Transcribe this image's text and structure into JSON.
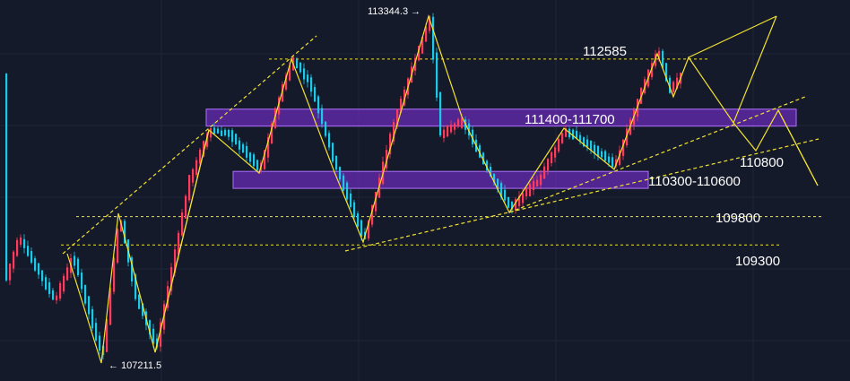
{
  "chart_data": {
    "type": "candlestick",
    "title": "",
    "xlabel": "",
    "ylabel": "",
    "ylim": [
      106500,
      114000
    ],
    "colors": {
      "background": "#141a2a",
      "up_candle": "#ff3b5c",
      "down_candle": "#1ec8e6",
      "annotation": "#f2e230",
      "zone_fill": "#7a2fd6",
      "zone_border": "#b070ff",
      "text": "#ffffff"
    },
    "candles": [],
    "levels": [
      {
        "label": "112585",
        "value": 112585
      },
      {
        "label": "109800",
        "value": 109800
      },
      {
        "label": "109300",
        "value": 109300
      }
    ],
    "zones": [
      {
        "label": "111400-111700",
        "low": 111400,
        "high": 111700
      },
      {
        "label": "110300-110600",
        "low": 110300,
        "high": 110600
      }
    ],
    "trendline_labels": [
      {
        "label": "110800",
        "value": 110800
      }
    ],
    "extremes": [
      {
        "label": "113344.3",
        "value": 113344.3,
        "kind": "high"
      },
      {
        "label": "← 107211.5",
        "value": 107211.5,
        "kind": "low"
      }
    ]
  }
}
